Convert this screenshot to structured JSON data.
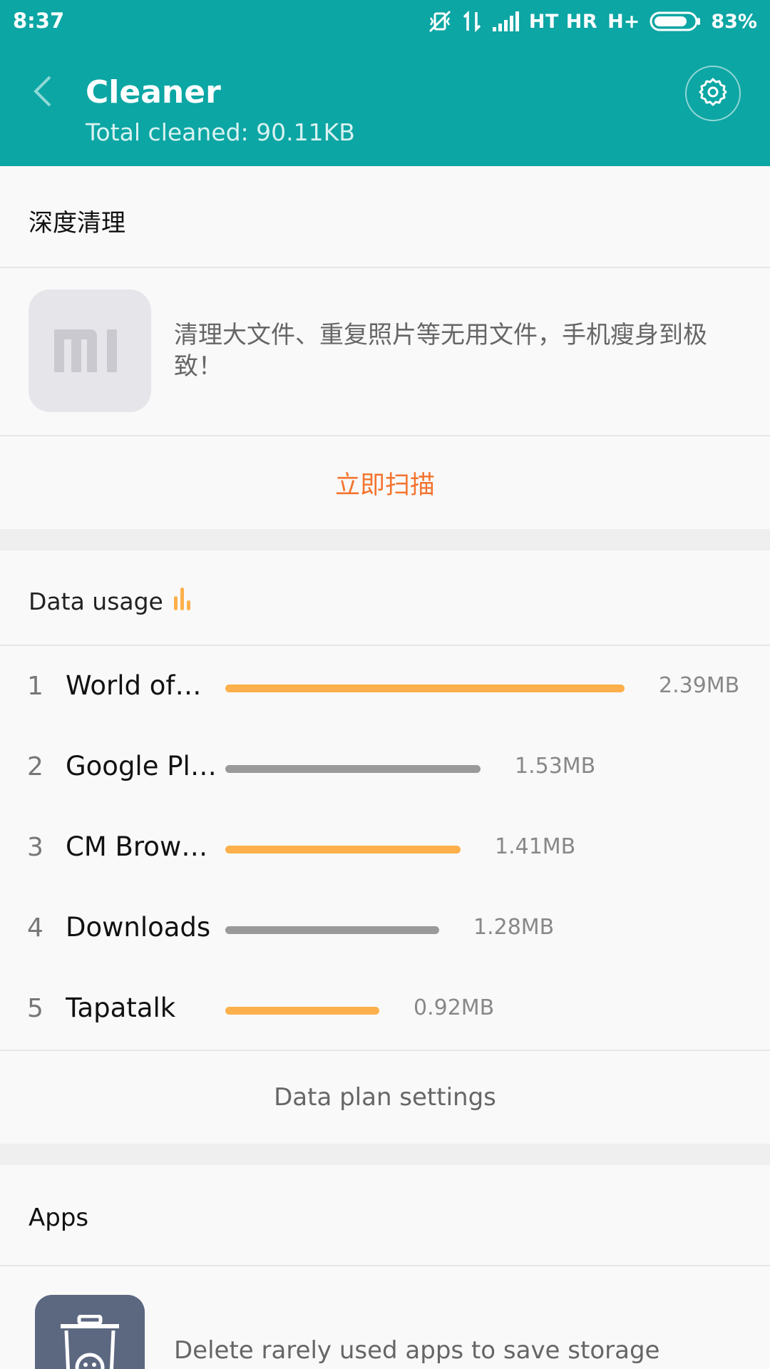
{
  "status_bar": {
    "time": "8:37",
    "carrier": "HT HR",
    "network": "H+",
    "battery": "83%",
    "battery_level": 0.83
  },
  "header": {
    "title": "Cleaner",
    "subtitle": "Total cleaned: 90.11KB",
    "back_icon": "chevron-left-icon",
    "settings_icon": "gear-icon"
  },
  "deep_clean": {
    "title": "深度清理",
    "description": "清理大文件、重复照片等无用文件，手机瘦身到极致！",
    "scan_label": "立即扫描"
  },
  "data_usage": {
    "title": "Data usage",
    "items": [
      {
        "rank": "1",
        "name": "World of…",
        "value": "2.39MB",
        "mb": 2.39,
        "color": "#fdb04b"
      },
      {
        "rank": "2",
        "name": "Google Pl…",
        "value": "1.53MB",
        "mb": 1.53,
        "color": "#9a9a9a"
      },
      {
        "rank": "3",
        "name": "CM Brow…",
        "value": "1.41MB",
        "mb": 1.41,
        "color": "#fdb04b"
      },
      {
        "rank": "4",
        "name": "Downloads",
        "value": "1.28MB",
        "mb": 1.28,
        "color": "#9a9a9a"
      },
      {
        "rank": "5",
        "name": "Tapatalk",
        "value": "0.92MB",
        "mb": 0.92,
        "color": "#fdb04b"
      }
    ],
    "plan_settings_label": "Data plan settings"
  },
  "apps": {
    "title": "Apps",
    "description": "Delete rarely used apps to save storage"
  },
  "colors": {
    "header": "#0ca6a4",
    "accent_orange": "#f3742f",
    "bar_orange": "#fdb04b",
    "bar_gray": "#9a9a9a"
  }
}
